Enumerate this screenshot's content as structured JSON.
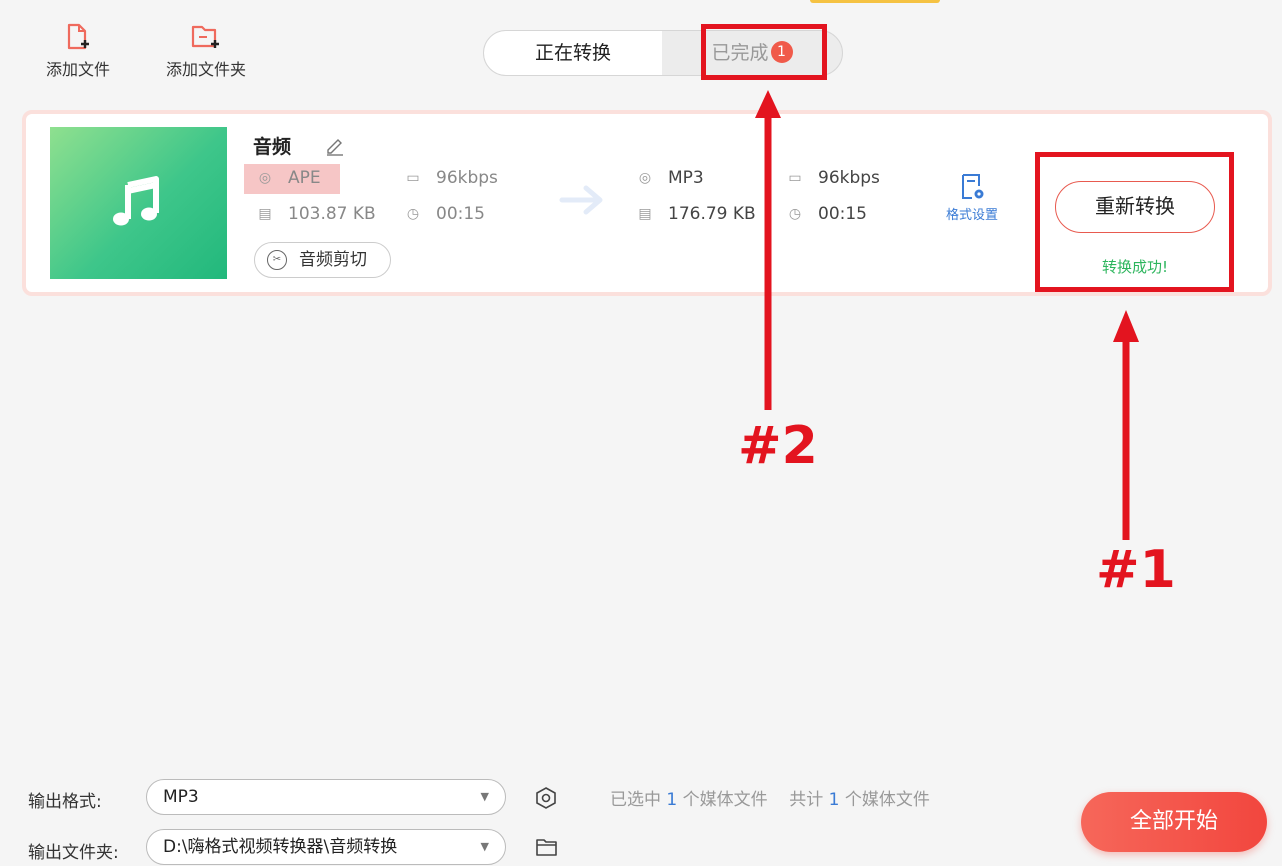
{
  "colors": {
    "accent": "#e85a4f",
    "success": "#2db55d",
    "link_blue": "#3a7bd5",
    "annotation_red": "#e3141f",
    "thumb_green": "#3ec68a"
  },
  "toolbar": {
    "add_file_label": "添加文件",
    "add_folder_label": "添加文件夹",
    "add_file_icon": "file-plus-icon",
    "add_folder_icon": "folder-plus-icon"
  },
  "tabs": {
    "converting_label": "正在转换",
    "completed_label": "已完成",
    "completed_count": "1"
  },
  "file": {
    "name": "音频",
    "thumb_icon": "music-note-icon",
    "source": {
      "format": "APE",
      "bitrate": "96kbps",
      "size": "103.87 KB",
      "duration": "00:15"
    },
    "target": {
      "format": "MP3",
      "bitrate": "96kbps",
      "size": "176.79 KB",
      "duration": "00:15"
    },
    "cut_label": "音频剪切",
    "format_settings_label": "格式设置",
    "reconvert_label": "重新转换",
    "status": "转换成功!"
  },
  "annotations": {
    "label_1": "#1",
    "label_2": "#2"
  },
  "bottom": {
    "output_format_label": "输出格式:",
    "output_format_value": "MP3",
    "output_folder_label": "输出文件夹:",
    "output_folder_value": "D:\\嗨格式视频转换器\\音频转换",
    "selected_prefix": "已选中",
    "selected_count": "1",
    "selected_suffix": "个媒体文件",
    "total_prefix": "共计",
    "total_count": "1",
    "total_suffix": "个媒体文件",
    "start_all_label": "全部开始"
  }
}
